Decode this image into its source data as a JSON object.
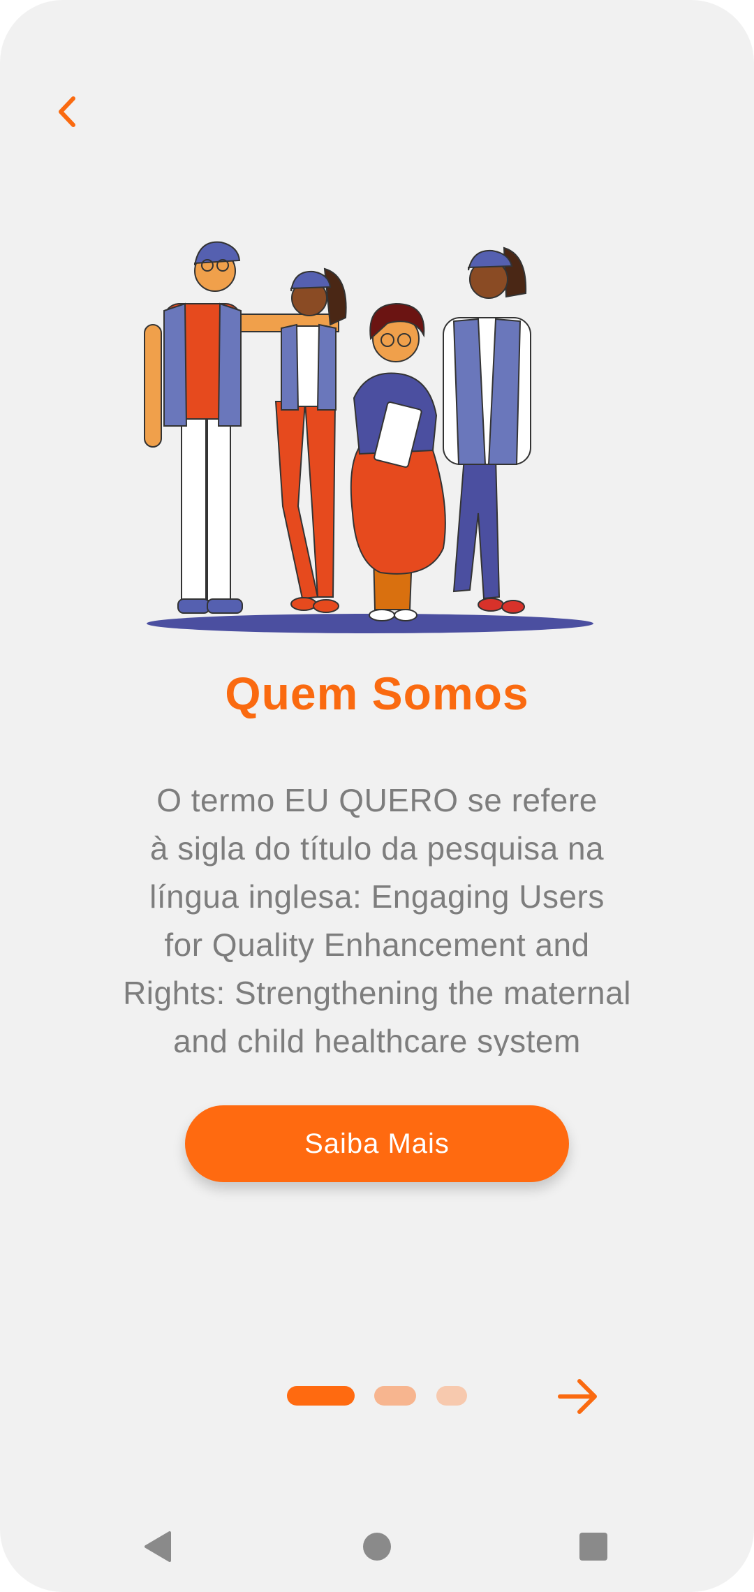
{
  "header": {
    "back_icon": "chevron-left-icon"
  },
  "illustration": {
    "icon": "volunteers-group-illustration"
  },
  "slide": {
    "title": "Quem Somos",
    "body_lines": [
      "O termo EU QUERO se refere",
      "à sigla do título da pesquisa na",
      "língua inglesa: Engaging Users",
      "for Quality Enhancement and",
      "Rights: Strengthening the maternal",
      "and child healthcare system"
    ],
    "cta_label": "Saiba Mais"
  },
  "pager": {
    "total": 3,
    "current": 1,
    "next_icon": "arrow-right-icon"
  },
  "system_nav": {
    "back_icon": "triangle-back-icon",
    "home_icon": "circle-home-icon",
    "recents_icon": "square-recents-icon"
  },
  "colors": {
    "accent": "#ff6a10",
    "background": "#f1f1f1",
    "text_gray": "#7d7d7d",
    "illustration_blue": "#6a77bb",
    "illustration_orange": "#e64a1e"
  }
}
